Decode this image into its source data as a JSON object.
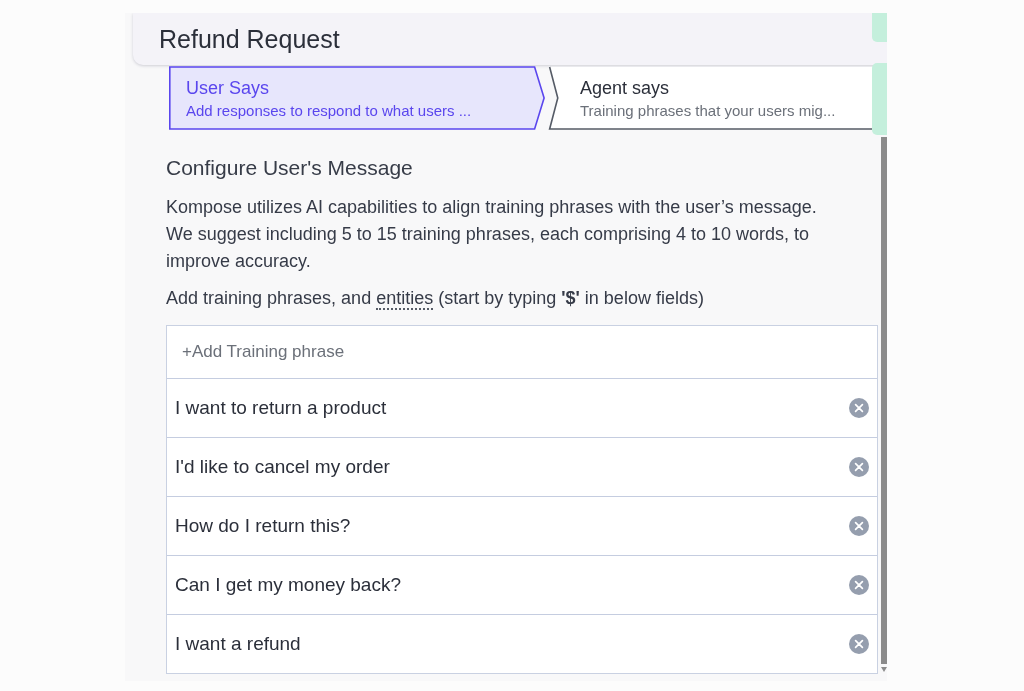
{
  "header": {
    "title": "Refund Request"
  },
  "tabs": [
    {
      "title": "User Says",
      "subtitle": "Add responses to respond to what users ...",
      "selected": true
    },
    {
      "title": "Agent says",
      "subtitle": "Training phrases that your users mig...",
      "selected": false
    }
  ],
  "section": {
    "heading": "Configure User's Message",
    "description": "Kompose utilizes AI capabilities to align training phrases with the user’s message. We suggest including 5 to 15 training phrases, each comprising 4 to 10 words, to improve accuracy.",
    "instruction_before": "Add training phrases, and",
    "instruction_link": "entities",
    "instruction_after": "(start by typing **'$'** in below fields)"
  },
  "phrases": {
    "placeholder": "+Add Training phrase",
    "items": [
      {
        "text": "I want to return a product"
      },
      {
        "text": "I'd like to cancel my order"
      },
      {
        "text": "How do I return this?"
      },
      {
        "text": "Can I get my money back?"
      },
      {
        "text": "I want a refund"
      }
    ]
  }
}
